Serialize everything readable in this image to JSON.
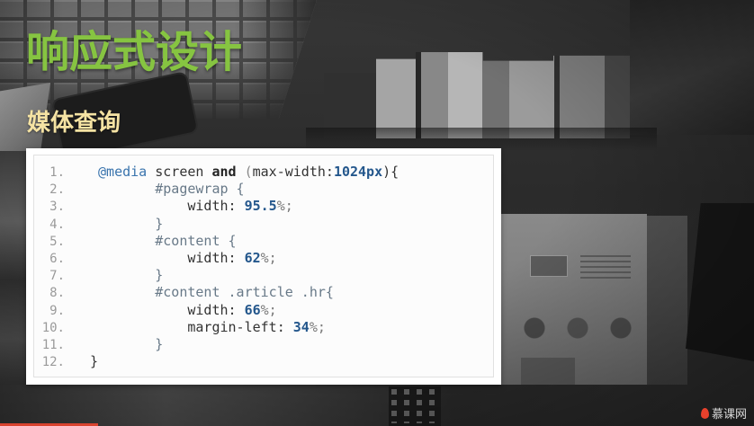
{
  "slide": {
    "title": "响应式设计",
    "subtitle": "媒体查询"
  },
  "code_block": {
    "lines": [
      {
        "number": "1.",
        "tokens": [
          {
            "text": " @media",
            "type": "at-rule"
          },
          {
            "text": " screen ",
            "type": "plain"
          },
          {
            "text": "and",
            "type": "logic"
          },
          {
            "text": " (",
            "type": "punct"
          },
          {
            "text": "max-width:",
            "type": "plain"
          },
          {
            "text": "1024px",
            "type": "number"
          },
          {
            "text": "){",
            "type": "plain"
          }
        ]
      },
      {
        "number": "2.",
        "tokens": [
          {
            "text": "        #pagewrap {",
            "type": "selector"
          }
        ]
      },
      {
        "number": "3.",
        "tokens": [
          {
            "text": "            width: ",
            "type": "plain"
          },
          {
            "text": "95.5",
            "type": "number"
          },
          {
            "text": "%;",
            "type": "unit"
          }
        ]
      },
      {
        "number": "4.",
        "tokens": [
          {
            "text": "        }",
            "type": "selector"
          }
        ]
      },
      {
        "number": "5.",
        "tokens": [
          {
            "text": "        #content {",
            "type": "selector"
          }
        ]
      },
      {
        "number": "6.",
        "tokens": [
          {
            "text": "            width: ",
            "type": "plain"
          },
          {
            "text": "62",
            "type": "number"
          },
          {
            "text": "%;",
            "type": "unit"
          }
        ]
      },
      {
        "number": "7.",
        "tokens": [
          {
            "text": "        }",
            "type": "selector"
          }
        ]
      },
      {
        "number": "8.",
        "tokens": [
          {
            "text": "        #content .article .hr{",
            "type": "selector"
          }
        ]
      },
      {
        "number": "9.",
        "tokens": [
          {
            "text": "            width: ",
            "type": "plain"
          },
          {
            "text": "66",
            "type": "number"
          },
          {
            "text": "%;",
            "type": "unit"
          }
        ]
      },
      {
        "number": "10.",
        "tokens": [
          {
            "text": "            margin-left: ",
            "type": "plain"
          },
          {
            "text": "34",
            "type": "number"
          },
          {
            "text": "%;",
            "type": "unit"
          }
        ]
      },
      {
        "number": "11.",
        "tokens": [
          {
            "text": "        }",
            "type": "selector"
          }
        ]
      },
      {
        "number": "12.",
        "tokens": [
          {
            "text": "}",
            "type": "plain"
          }
        ]
      }
    ]
  },
  "watermark": {
    "text": "慕课网",
    "icon": "flame-logo-icon"
  },
  "video": {
    "progress": 0.13
  },
  "colors": {
    "title": "#86c441",
    "subtitle": "#f5e3a3",
    "line_number": "#9a9a9a",
    "progress": "#d9432f",
    "syntax": {
      "at-rule": "#3a74ad",
      "plain": "#333333",
      "logic": "#222222",
      "punct": "#8a8a8a",
      "number": "#24578c",
      "selector": "#687988",
      "unit": "#7a7a7a"
    }
  }
}
